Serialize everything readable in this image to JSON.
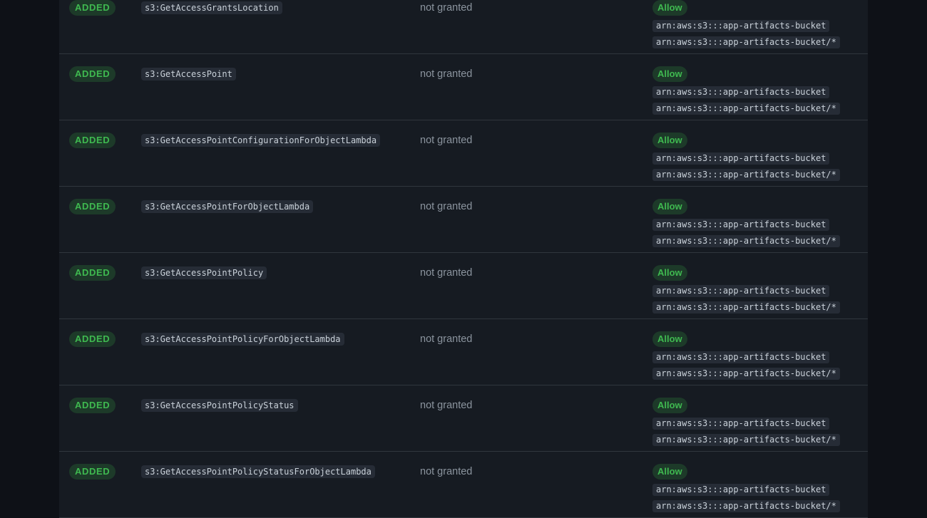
{
  "changes": [
    {
      "status": "ADDED",
      "action": "s3:GetAccessGrantsLocation",
      "previous": "not granted",
      "effect": "Allow",
      "resources": [
        "arn:aws:s3:::app-artifacts-bucket",
        "arn:aws:s3:::app-artifacts-bucket/*"
      ]
    },
    {
      "status": "ADDED",
      "action": "s3:GetAccessPoint",
      "previous": "not granted",
      "effect": "Allow",
      "resources": [
        "arn:aws:s3:::app-artifacts-bucket",
        "arn:aws:s3:::app-artifacts-bucket/*"
      ]
    },
    {
      "status": "ADDED",
      "action": "s3:GetAccessPointConfigurationForObjectLambda",
      "previous": "not granted",
      "effect": "Allow",
      "resources": [
        "arn:aws:s3:::app-artifacts-bucket",
        "arn:aws:s3:::app-artifacts-bucket/*"
      ]
    },
    {
      "status": "ADDED",
      "action": "s3:GetAccessPointForObjectLambda",
      "previous": "not granted",
      "effect": "Allow",
      "resources": [
        "arn:aws:s3:::app-artifacts-bucket",
        "arn:aws:s3:::app-artifacts-bucket/*"
      ]
    },
    {
      "status": "ADDED",
      "action": "s3:GetAccessPointPolicy",
      "previous": "not granted",
      "effect": "Allow",
      "resources": [
        "arn:aws:s3:::app-artifacts-bucket",
        "arn:aws:s3:::app-artifacts-bucket/*"
      ]
    },
    {
      "status": "ADDED",
      "action": "s3:GetAccessPointPolicyForObjectLambda",
      "previous": "not granted",
      "effect": "Allow",
      "resources": [
        "arn:aws:s3:::app-artifacts-bucket",
        "arn:aws:s3:::app-artifacts-bucket/*"
      ]
    },
    {
      "status": "ADDED",
      "action": "s3:GetAccessPointPolicyStatus",
      "previous": "not granted",
      "effect": "Allow",
      "resources": [
        "arn:aws:s3:::app-artifacts-bucket",
        "arn:aws:s3:::app-artifacts-bucket/*"
      ]
    },
    {
      "status": "ADDED",
      "action": "s3:GetAccessPointPolicyStatusForObjectLambda",
      "previous": "not granted",
      "effect": "Allow",
      "resources": [
        "arn:aws:s3:::app-artifacts-bucket",
        "arn:aws:s3:::app-artifacts-bucket/*"
      ]
    }
  ],
  "colors": {
    "page_background": "#0e1117",
    "panel_background": "#161b22",
    "row_divider": "#30363d",
    "badge_green_text": "#3fb950",
    "badge_green_bg": "#1d3a29",
    "code_bg": "#262c36",
    "muted_text": "#8b949e"
  }
}
